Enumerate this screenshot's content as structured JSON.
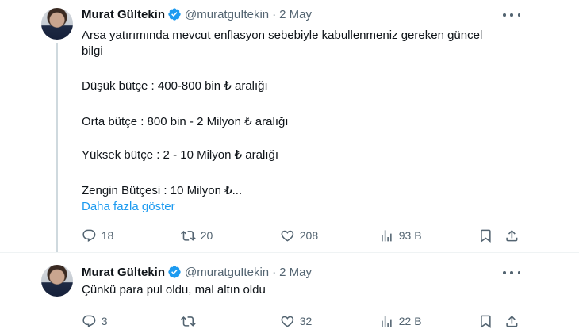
{
  "tweets": [
    {
      "author": {
        "name": "Murat Gültekin",
        "handle": "@muratguItekin",
        "verified": true
      },
      "date": "2 May",
      "text_lines": [
        "Arsa yatırımında mevcut enflasyon sebebiyle kabullenmeniz gereken güncel",
        "bilgi",
        "",
        "Düşük bütçe : 400-800 bin ₺ aralığı",
        "",
        "Orta bütçe : 800 bin - 2 Milyon ₺ aralığı",
        "",
        "Yüksek bütçe : 2 - 10 Milyon ₺ aralığı",
        "",
        "Zengin Bütçesi : 10 Milyon ₺..."
      ],
      "show_more": "Daha fazla göster",
      "stats": {
        "replies": "18",
        "retweets": "20",
        "likes": "208",
        "views": "93 B"
      }
    },
    {
      "author": {
        "name": "Murat Gültekin",
        "handle": "@muratguItekin",
        "verified": true
      },
      "date": "2 May",
      "text": "Çünkü para pul oldu, mal altın oldu",
      "stats": {
        "replies": "3",
        "retweets": "",
        "likes": "32",
        "views": "22 B"
      }
    }
  ],
  "dot_separator": "·",
  "colors": {
    "accent": "#1d9bf0",
    "text": "#0f1419",
    "secondary": "#536471",
    "thread_line": "#cfd9de"
  },
  "icons": [
    "verified-badge-icon",
    "more-icon",
    "reply-icon",
    "retweet-icon",
    "like-icon",
    "views-icon",
    "bookmark-icon",
    "share-icon"
  ]
}
